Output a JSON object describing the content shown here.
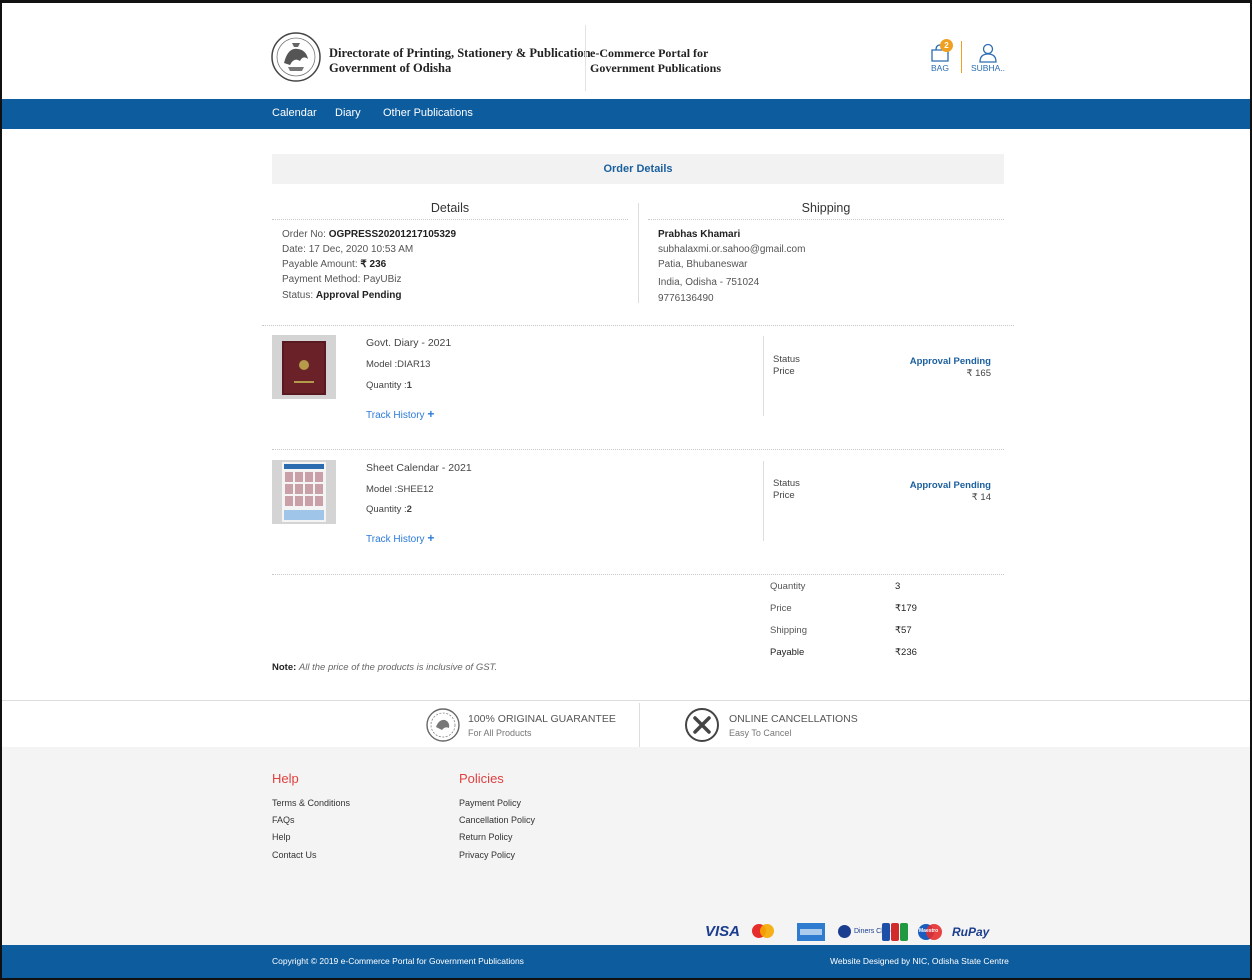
{
  "header": {
    "dept_line1": "Directorate of Printing, Stationery & Publication",
    "dept_line2": "Government of Odisha",
    "portal_line1": "e-Commerce Portal for",
    "portal_line2": "Government Publications",
    "bag_count": "2",
    "bag_label": "BAG",
    "user_label": "SUBHA.."
  },
  "nav": {
    "items": [
      "Calendar",
      "Diary",
      "Other Publications"
    ]
  },
  "order": {
    "title": "Order Details",
    "details_heading": "Details",
    "shipping_heading": "Shipping",
    "order_no_label": "Order No:",
    "order_no": "OGPRESS20201217105329",
    "date_label": "Date:",
    "date": "17 Dec, 2020 10:53 AM",
    "payable_label": "Payable Amount:",
    "payable": "₹ 236",
    "method_label": "Payment Method:",
    "method": "PayUBiz",
    "status_label": "Status:",
    "status": "Approval Pending",
    "ship_name": "Prabhas Khamari",
    "ship_email": "subhalaxmi.or.sahoo@gmail.com",
    "ship_addr1": "Patia, Bhubaneswar",
    "ship_addr2": "India, Odisha - 751024",
    "ship_phone": "9776136490"
  },
  "items": [
    {
      "name": "Govt. Diary - 2021",
      "model_label": "Model :",
      "model": "DIAR13",
      "qty_label": "Quantity :",
      "qty": "1",
      "track": "Track History",
      "status_label": "Status",
      "status": "Approval Pending",
      "price_label": "Price",
      "price": "₹ 165"
    },
    {
      "name": "Sheet Calendar - 2021",
      "model_label": "Model :",
      "model": "SHEE12",
      "qty_label": "Quantity :",
      "qty": "2",
      "track": "Track History",
      "status_label": "Status",
      "status": "Approval Pending",
      "price_label": "Price",
      "price": "₹ 14"
    }
  ],
  "summary": {
    "quantity_label": "Quantity",
    "quantity": "3",
    "price_label": "Price",
    "price": "₹179",
    "shipping_label": "Shipping",
    "shipping": "₹57",
    "payable_label": "Payable",
    "payable": "₹236"
  },
  "note": {
    "label": "Note:",
    "text": "All the price of the products is inclusive of GST."
  },
  "guarantees": [
    {
      "title": "100% ORIGINAL GUARANTEE",
      "sub": "For All Products",
      "icon": "original-guarantee-icon"
    },
    {
      "title": "ONLINE CANCELLATIONS",
      "sub": "Easy To Cancel",
      "icon": "cancel-icon"
    }
  ],
  "footer": {
    "help_heading": "Help",
    "help_links": [
      "Terms & Conditions",
      "FAQs",
      "Help",
      "Contact Us"
    ],
    "policies_heading": "Policies",
    "policy_links": [
      "Payment Policy",
      "Cancellation Policy",
      "Return Policy",
      "Privacy Policy"
    ],
    "payment_logos": [
      "VISA",
      "Mastercard",
      "American Express",
      "Diners Club",
      "JCB",
      "Maestro",
      "RuPay"
    ],
    "visa_text": "VISA",
    "diners_text": "Diners Club",
    "maestro_text": "Maestro",
    "rupay_text": "RuPay",
    "copyright": "Copyright © 2019 e-Commerce Portal for Government Publications",
    "designed_by": "Website Designed by NIC, Odisha State Centre"
  },
  "colors": {
    "nav": "#0d5c9e",
    "link": "#2b7bd8",
    "status": "#1a5f9e",
    "badge": "#f0a020",
    "footer_heading": "#e04040"
  }
}
